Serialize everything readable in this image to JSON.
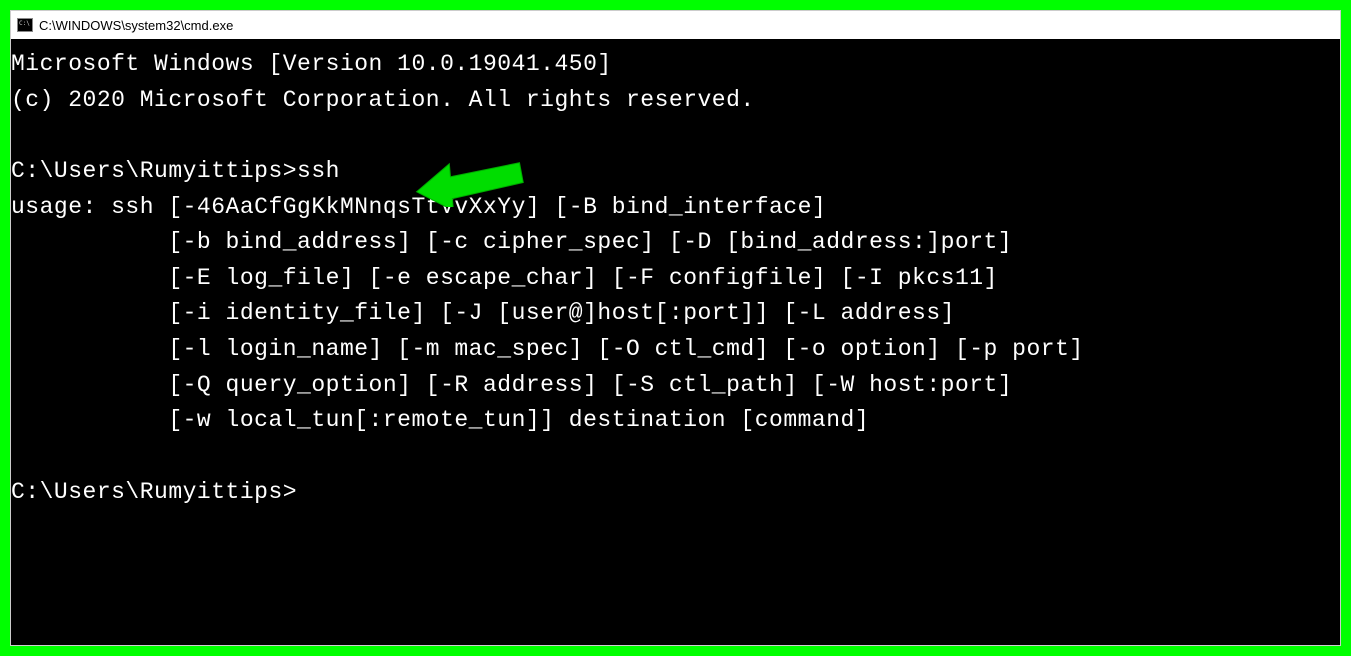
{
  "titlebar": {
    "text": "C:\\WINDOWS\\system32\\cmd.exe"
  },
  "terminal": {
    "line1": "Microsoft Windows [Version 10.0.19041.450]",
    "line2": "(c) 2020 Microsoft Corporation. All rights reserved.",
    "blank1": "",
    "prompt1": "C:\\Users\\Rumyittips>ssh",
    "usage1": "usage: ssh [-46AaCfGgKkMNnqsTtVvXxYy] [-B bind_interface]",
    "usage2": "           [-b bind_address] [-c cipher_spec] [-D [bind_address:]port]",
    "usage3": "           [-E log_file] [-e escape_char] [-F configfile] [-I pkcs11]",
    "usage4": "           [-i identity_file] [-J [user@]host[:port]] [-L address]",
    "usage5": "           [-l login_name] [-m mac_spec] [-O ctl_cmd] [-o option] [-p port]",
    "usage6": "           [-Q query_option] [-R address] [-S ctl_path] [-W host:port]",
    "usage7": "           [-w local_tun[:remote_tun]] destination [command]",
    "blank2": "",
    "prompt2": "C:\\Users\\Rumyittips>"
  },
  "annotation": {
    "color": "#00ff00"
  }
}
